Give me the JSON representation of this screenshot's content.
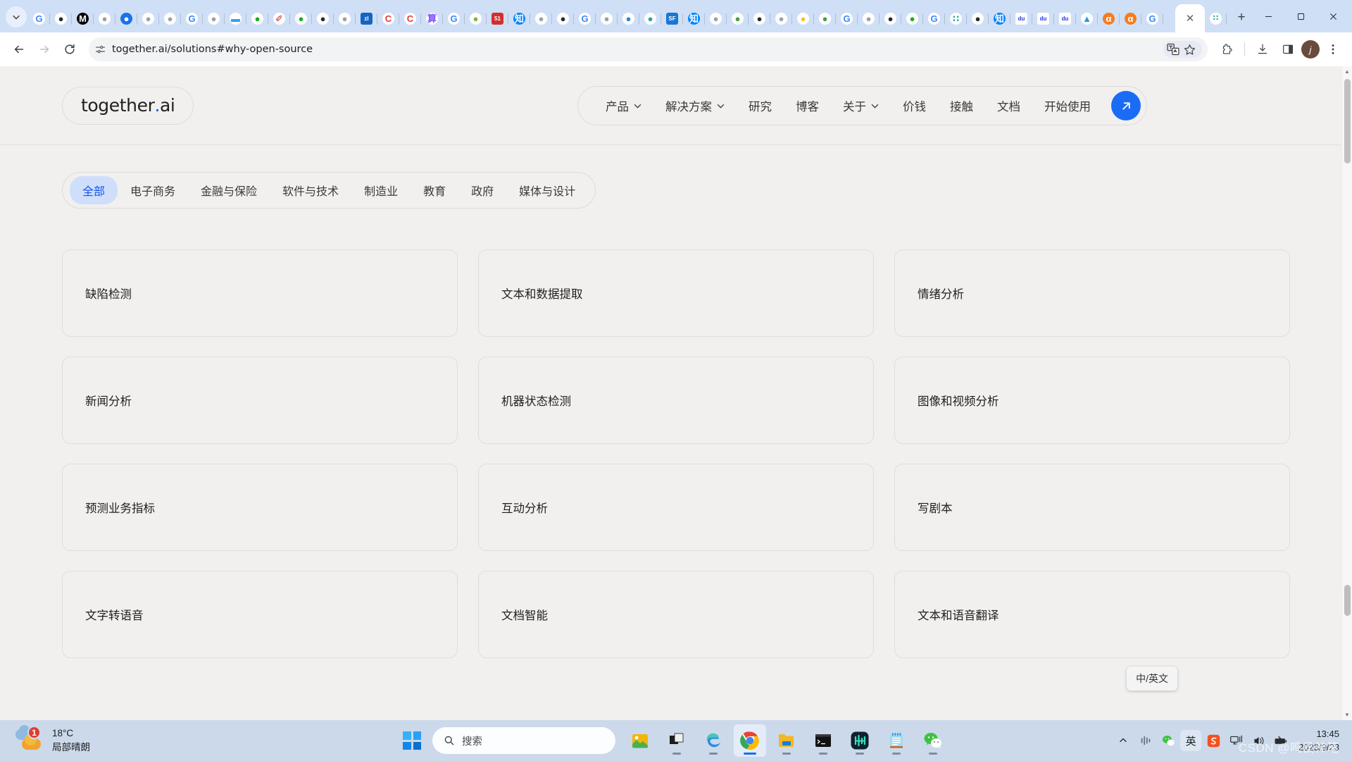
{
  "browser": {
    "tabs_chevron_icon": "chevron-down-icon",
    "new_tab_icon": "plus-icon",
    "close_tab_icon": "close-icon",
    "pinned_tabs": [
      {
        "name": "google",
        "glyph": "G",
        "bg": "#ffffff",
        "fg": "#4285f4"
      },
      {
        "name": "github",
        "glyph": "●",
        "bg": "#ffffff",
        "fg": "#24292f"
      },
      {
        "name": "medium",
        "glyph": "M",
        "bg": "#000000",
        "fg": "#ffffff"
      },
      {
        "name": "globe",
        "glyph": "●",
        "bg": "#ffffff",
        "fg": "#9aa0a6"
      },
      {
        "name": "chat",
        "glyph": "●",
        "bg": "#1a73e8",
        "fg": "#ffffff"
      },
      {
        "name": "globe",
        "glyph": "●",
        "bg": "#ffffff",
        "fg": "#9aa0a6"
      },
      {
        "name": "globe",
        "glyph": "●",
        "bg": "#ffffff",
        "fg": "#9aa0a6"
      },
      {
        "name": "google",
        "glyph": "G",
        "bg": "#ffffff",
        "fg": "#4285f4"
      },
      {
        "name": "globe",
        "glyph": "●",
        "bg": "#ffffff",
        "fg": "#9aa0a6"
      },
      {
        "name": "car",
        "glyph": "▬",
        "bg": "#ffffff",
        "fg": "#35a0e0"
      },
      {
        "name": "wechat",
        "glyph": "●",
        "bg": "#ffffff",
        "fg": "#1aad19"
      },
      {
        "name": "feather",
        "glyph": "✐",
        "bg": "#ffffff",
        "fg": "#c62828"
      },
      {
        "name": "wechat",
        "glyph": "●",
        "bg": "#ffffff",
        "fg": "#1aad19"
      },
      {
        "name": "github",
        "glyph": "●",
        "bg": "#ffffff",
        "fg": "#24292f"
      },
      {
        "name": "globe",
        "glyph": "●",
        "bg": "#ffffff",
        "fg": "#9aa0a6"
      },
      {
        "name": "zl",
        "glyph": "zl",
        "bg": "#1565c0",
        "fg": "#ffffff"
      },
      {
        "name": "c",
        "glyph": "C",
        "bg": "#ffffff",
        "fg": "#e53935"
      },
      {
        "name": "c",
        "glyph": "C",
        "bg": "#ffffff",
        "fg": "#e53935"
      },
      {
        "name": "purple",
        "glyph": "算",
        "bg": "#ffffff",
        "fg": "#7c4dff"
      },
      {
        "name": "google",
        "glyph": "G",
        "bg": "#ffffff",
        "fg": "#4285f4"
      },
      {
        "name": "frog",
        "glyph": "●",
        "bg": "#ffffff",
        "fg": "#7cb342"
      },
      {
        "name": "51",
        "glyph": "51",
        "bg": "#d32f2f",
        "fg": "#ffffff"
      },
      {
        "name": "zhihu",
        "glyph": "知",
        "bg": "#0084ff",
        "fg": "#ffffff"
      },
      {
        "name": "globe",
        "glyph": "●",
        "bg": "#ffffff",
        "fg": "#9aa0a6"
      },
      {
        "name": "github",
        "glyph": "●",
        "bg": "#ffffff",
        "fg": "#24292f"
      },
      {
        "name": "google",
        "glyph": "G",
        "bg": "#ffffff",
        "fg": "#4285f4"
      },
      {
        "name": "globe",
        "glyph": "●",
        "bg": "#ffffff",
        "fg": "#9aa0a6"
      },
      {
        "name": "blue",
        "glyph": "●",
        "bg": "#ffffff",
        "fg": "#1e88e5"
      },
      {
        "name": "teal",
        "glyph": "●",
        "bg": "#ffffff",
        "fg": "#26a69a"
      },
      {
        "name": "sf",
        "glyph": "SF",
        "bg": "#1976d2",
        "fg": "#ffffff"
      },
      {
        "name": "zhihu",
        "glyph": "知",
        "bg": "#0084ff",
        "fg": "#ffffff"
      },
      {
        "name": "globe",
        "glyph": "●",
        "bg": "#ffffff",
        "fg": "#9aa0a6"
      },
      {
        "name": "green",
        "glyph": "●",
        "bg": "#ffffff",
        "fg": "#43a047"
      },
      {
        "name": "github",
        "glyph": "●",
        "bg": "#ffffff",
        "fg": "#24292f"
      },
      {
        "name": "globe",
        "glyph": "●",
        "bg": "#ffffff",
        "fg": "#9aa0a6"
      },
      {
        "name": "yellow",
        "glyph": "●",
        "bg": "#ffffff",
        "fg": "#fbc02d"
      },
      {
        "name": "green",
        "glyph": "●",
        "bg": "#ffffff",
        "fg": "#43a047"
      },
      {
        "name": "google",
        "glyph": "G",
        "bg": "#ffffff",
        "fg": "#4285f4"
      },
      {
        "name": "globe",
        "glyph": "●",
        "bg": "#ffffff",
        "fg": "#9aa0a6"
      },
      {
        "name": "github",
        "glyph": "●",
        "bg": "#ffffff",
        "fg": "#24292f"
      },
      {
        "name": "wechat",
        "glyph": "●",
        "bg": "#ffffff",
        "fg": "#1aad19"
      },
      {
        "name": "google",
        "glyph": "G",
        "bg": "#ffffff",
        "fg": "#4285f4"
      },
      {
        "name": "dots",
        "glyph": "∷",
        "bg": "#ffffff",
        "fg": "#26a69a"
      },
      {
        "name": "github",
        "glyph": "●",
        "bg": "#ffffff",
        "fg": "#24292f"
      },
      {
        "name": "zhihu",
        "glyph": "知",
        "bg": "#0084ff",
        "fg": "#ffffff"
      },
      {
        "name": "baidu",
        "glyph": "du",
        "bg": "#ffffff",
        "fg": "#2932e1"
      },
      {
        "name": "baidu",
        "glyph": "du",
        "bg": "#ffffff",
        "fg": "#2932e1"
      },
      {
        "name": "baidu",
        "glyph": "du",
        "bg": "#ffffff",
        "fg": "#2932e1"
      },
      {
        "name": "mountain",
        "glyph": "▲",
        "bg": "#ffffff",
        "fg": "#2196f3"
      },
      {
        "name": "orange",
        "glyph": "α",
        "bg": "#f57c20",
        "fg": "#ffffff"
      },
      {
        "name": "orange",
        "glyph": "α",
        "bg": "#f57c20",
        "fg": "#ffffff"
      },
      {
        "name": "google",
        "glyph": "G",
        "bg": "#ffffff",
        "fg": "#4285f4"
      }
    ],
    "window_controls": [
      "minimize",
      "maximize",
      "close"
    ],
    "toolbar": {
      "back_icon": "back-arrow-icon",
      "forward_icon": "forward-arrow-icon",
      "reload_icon": "reload-icon",
      "site_info_icon": "tune-icon",
      "url": "together.ai/solutions#why-open-source",
      "translate_icon": "translate-icon",
      "bookmark_icon": "star-icon",
      "extensions_icon": "extensions-icon",
      "downloads_icon": "download-icon",
      "side_panel_icon": "side-panel-icon",
      "profile_initial": "j",
      "menu_icon": "three-dot-menu-icon"
    }
  },
  "site": {
    "logo": {
      "text": "together",
      "dot": ".",
      "suffix": "ai"
    },
    "nav": [
      {
        "label": "产品",
        "has_chevron": true
      },
      {
        "label": "解决方案",
        "has_chevron": true
      },
      {
        "label": "研究",
        "has_chevron": false
      },
      {
        "label": "博客",
        "has_chevron": false
      },
      {
        "label": "关于",
        "has_chevron": true
      },
      {
        "label": "价钱",
        "has_chevron": false
      },
      {
        "label": "接触",
        "has_chevron": false
      },
      {
        "label": "文档",
        "has_chevron": false
      },
      {
        "label": "开始使用",
        "has_chevron": false
      }
    ],
    "cta_icon": "arrow-up-right-icon",
    "filters": [
      {
        "label": "全部",
        "active": true
      },
      {
        "label": "电子商务",
        "active": false
      },
      {
        "label": "金融与保险",
        "active": false
      },
      {
        "label": "软件与技术",
        "active": false
      },
      {
        "label": "制造业",
        "active": false
      },
      {
        "label": "教育",
        "active": false
      },
      {
        "label": "政府",
        "active": false
      },
      {
        "label": "媒体与设计",
        "active": false
      }
    ],
    "cards": [
      {
        "title": "缺陷检测"
      },
      {
        "title": "文本和数据提取"
      },
      {
        "title": "情绪分析"
      },
      {
        "title": "新闻分析"
      },
      {
        "title": "机器状态检测"
      },
      {
        "title": "图像和视频分析"
      },
      {
        "title": "预测业务指标"
      },
      {
        "title": "互动分析"
      },
      {
        "title": "写剧本"
      },
      {
        "title": "文字转语音"
      },
      {
        "title": "文档智能"
      },
      {
        "title": "文本和语音翻译"
      }
    ],
    "tooltip": "中/英文",
    "accent_color": "#1452f0",
    "chip_active_bg": "#cfdffb"
  },
  "taskbar": {
    "weather": {
      "temperature": "18°C",
      "condition": "局部晴朗",
      "badge": "1"
    },
    "start_icon": "windows-logo-icon",
    "search": {
      "placeholder": "搜索",
      "icon": "search-icon"
    },
    "apps": [
      {
        "name": "photos",
        "running": false,
        "active": false
      },
      {
        "name": "file-explorer-dark",
        "running": true,
        "active": false
      },
      {
        "name": "microsoft-edge",
        "running": true,
        "active": false
      },
      {
        "name": "google-chrome",
        "running": true,
        "active": true
      },
      {
        "name": "file-explorer",
        "running": true,
        "active": false
      },
      {
        "name": "terminal",
        "running": true,
        "active": false
      },
      {
        "name": "app-teal",
        "running": true,
        "active": false
      },
      {
        "name": "notepad",
        "running": true,
        "active": false
      },
      {
        "name": "wechat",
        "running": true,
        "active": false
      }
    ],
    "tray": [
      {
        "name": "show-hidden-icons",
        "glyph": "⌃"
      },
      {
        "name": "app-tray-icon",
        "glyph": "‖"
      },
      {
        "name": "wechat-tray-icon",
        "glyph": "●"
      },
      {
        "name": "ime-mode",
        "glyph": "英"
      },
      {
        "name": "sogou-input",
        "glyph": "S"
      },
      {
        "name": "network-icon",
        "glyph": "⎙"
      },
      {
        "name": "volume-icon",
        "glyph": "◂"
      },
      {
        "name": "battery-icon",
        "glyph": "■"
      }
    ],
    "clock": {
      "time": "13:45",
      "date": "2023/9/23"
    },
    "watermark": "CSDN @鸣侯神笔"
  }
}
